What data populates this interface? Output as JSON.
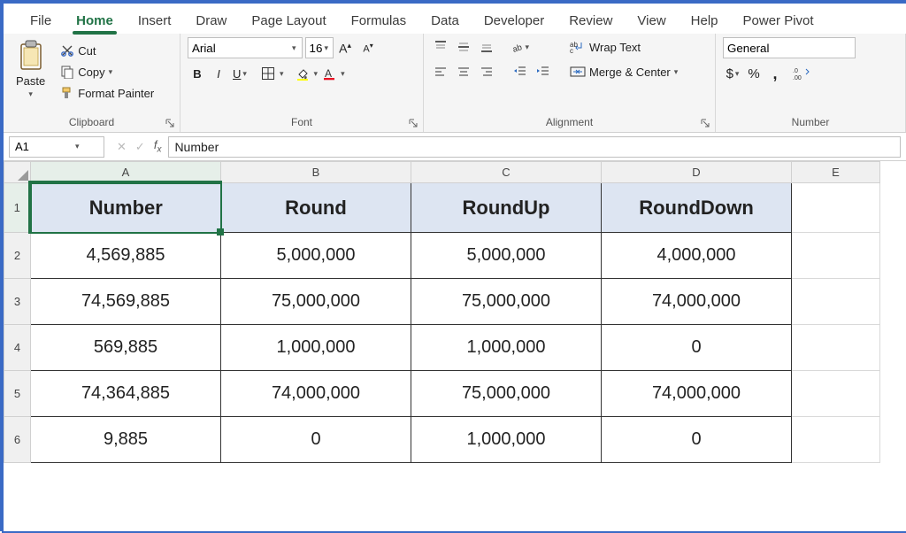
{
  "tabs": [
    "File",
    "Home",
    "Insert",
    "Draw",
    "Page Layout",
    "Formulas",
    "Data",
    "Developer",
    "Review",
    "View",
    "Help",
    "Power Pivot"
  ],
  "active_tab": "Home",
  "clipboard": {
    "paste": "Paste",
    "cut": "Cut",
    "copy": "Copy",
    "format_painter": "Format Painter",
    "group_label": "Clipboard"
  },
  "font": {
    "name": "Arial",
    "size": "16",
    "group_label": "Font"
  },
  "alignment": {
    "wrap": "Wrap Text",
    "merge": "Merge & Center",
    "group_label": "Alignment"
  },
  "number": {
    "format": "General",
    "group_label": "Number"
  },
  "namebox": "A1",
  "formula": "Number",
  "columns": [
    "A",
    "B",
    "C",
    "D",
    "E"
  ],
  "rows": [
    "1",
    "2",
    "3",
    "4",
    "5",
    "6"
  ],
  "table": {
    "headers": [
      "Number",
      "Round",
      "RoundUp",
      "RoundDown"
    ],
    "data": [
      [
        "4,569,885",
        "5,000,000",
        "5,000,000",
        "4,000,000"
      ],
      [
        "74,569,885",
        "75,000,000",
        "75,000,000",
        "74,000,000"
      ],
      [
        "569,885",
        "1,000,000",
        "1,000,000",
        "0"
      ],
      [
        "74,364,885",
        "74,000,000",
        "75,000,000",
        "74,000,000"
      ],
      [
        "9,885",
        "0",
        "1,000,000",
        "0"
      ]
    ]
  },
  "chart_data": {
    "type": "table",
    "columns": [
      "Number",
      "Round",
      "RoundUp",
      "RoundDown"
    ],
    "rows": [
      [
        4569885,
        5000000,
        5000000,
        4000000
      ],
      [
        74569885,
        75000000,
        75000000,
        74000000
      ],
      [
        569885,
        1000000,
        1000000,
        0
      ],
      [
        74364885,
        74000000,
        75000000,
        74000000
      ],
      [
        9885,
        0,
        1000000,
        0
      ]
    ]
  }
}
